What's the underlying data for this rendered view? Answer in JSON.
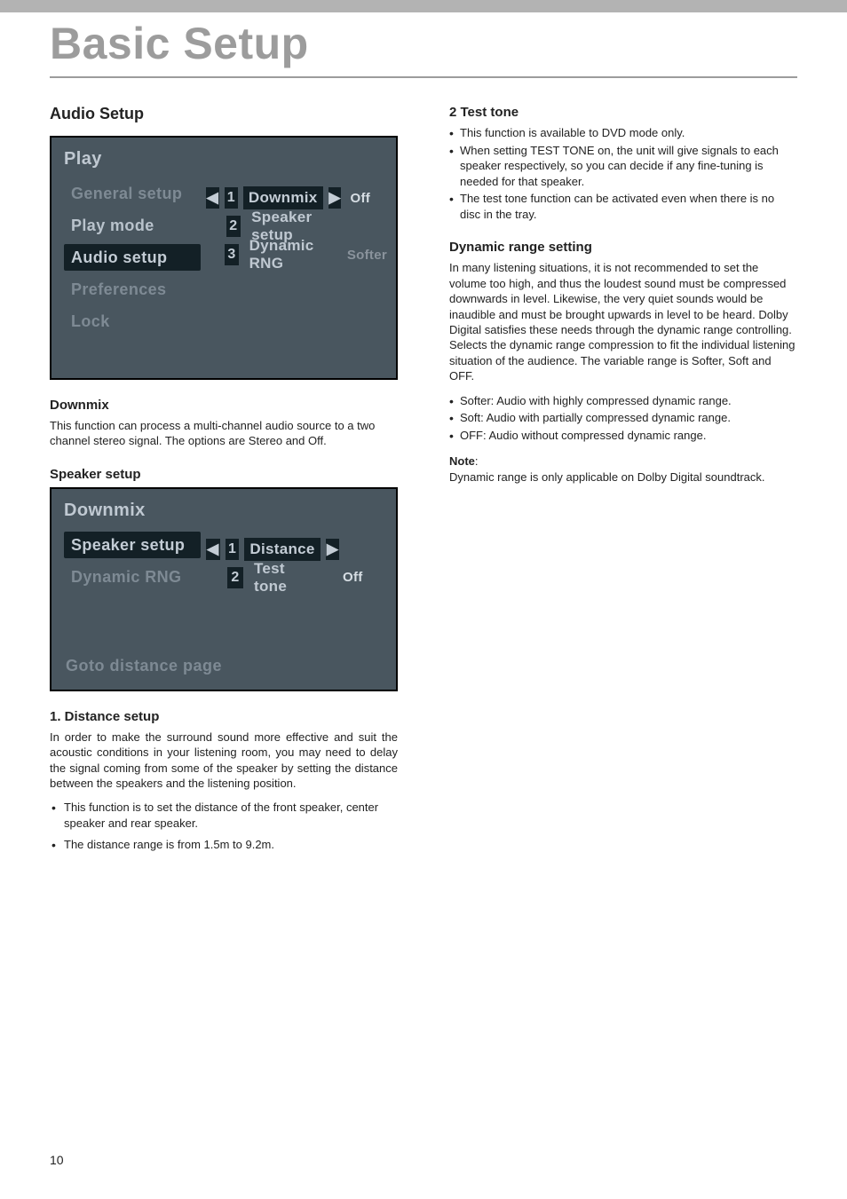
{
  "chapter": "Basic Setup",
  "page_number": "10",
  "left": {
    "section_title": "Audio Setup",
    "osd1": {
      "header": "Play",
      "sidebar": [
        "General setup",
        "Play mode",
        "Audio setup",
        "Preferences",
        "Lock"
      ],
      "selected_sidebar": "Audio setup",
      "rows": [
        {
          "num": "1",
          "label": "Downmix",
          "value": "Off",
          "left_arrow": true,
          "right_arrow": true,
          "label_sel": true
        },
        {
          "num": "2",
          "label": "Speaker setup",
          "value": "",
          "left_arrow": false,
          "right_arrow": false,
          "label_sel": false
        },
        {
          "num": "3",
          "label": "Dynamic RNG",
          "value": "Softer",
          "left_arrow": false,
          "right_arrow": false,
          "label_sel": false
        }
      ]
    },
    "downmix_head": "Downmix",
    "downmix_text": "This function can process a multi-channel audio source to a two channel stereo signal. The options are Stereo and Off.",
    "speaker_head": "Speaker setup",
    "osd2": {
      "header": "Downmix",
      "sidebar": [
        "Speaker setup",
        "Dynamic RNG"
      ],
      "selected_sidebar": "Speaker setup",
      "rows": [
        {
          "num": "1",
          "label": "Distance",
          "value": "",
          "left_arrow": true,
          "right_arrow": true,
          "label_sel": true
        },
        {
          "num": "2",
          "label": "Test tone",
          "value": "Off",
          "left_arrow": false,
          "right_arrow": false,
          "label_sel": false
        }
      ],
      "footer": "Goto distance page"
    },
    "distance_head": "1. Distance setup",
    "distance_text": "In order to make the surround sound more effective and suit the acoustic conditions in your listening room, you may need to delay the signal coming from some of the speaker by setting the distance between the speakers and the listening position.",
    "distance_bullets": [
      "This function is to set the distance of the front speaker, center speaker and rear speaker.",
      "The distance range is from 1.5m to 9.2m."
    ]
  },
  "right": {
    "tt_head": "2 Test tone",
    "tt_bullets": [
      "This function is available to DVD mode only.",
      "When setting TEST TONE on, the unit will give signals to each speaker respectively, so you can decide if any fine-tuning is needed for that speaker.",
      "The test tone function can be activated even when there is no disc in the tray."
    ],
    "drs_head": "Dynamic range setting",
    "drs_text": "In many listening situations, it is not recommended to set the volume too high, and thus the loudest sound must be compressed downwards in level. Likewise, the very quiet sounds would be inaudible and must be brought upwards in level to be heard. Dolby Digital satisfies these needs through the dynamic range controlling. Selects the dynamic range compression to fit the individual listening situation of the audience. The variable range is Softer, Soft and OFF.",
    "drs_bullets": [
      "Softer: Audio with highly compressed dynamic range.",
      "Soft: Audio with partially compressed dynamic range.",
      "OFF: Audio without compressed dynamic range."
    ],
    "note_label": "Note",
    "note_text": "Dynamic range is only applicable on Dolby Digital soundtrack."
  }
}
